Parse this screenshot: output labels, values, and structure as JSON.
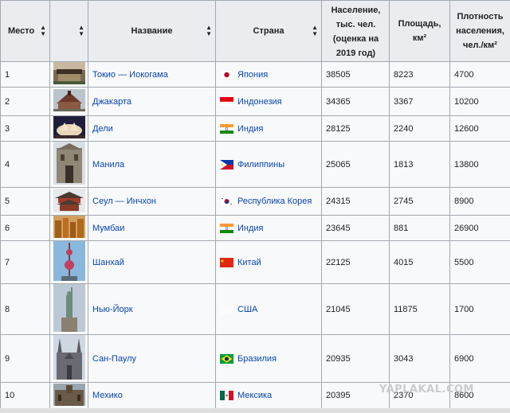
{
  "headers": {
    "rank": "Место",
    "photo": "",
    "name": "Название",
    "country": "Страна",
    "population": "Население, тыс. чел. (оценка на 2019 год)",
    "area": "Площадь, км²",
    "density": "Плотность населения, чел./км²"
  },
  "rows": [
    {
      "rank": "1",
      "name": "Токио — Иокогама",
      "country": "Япония",
      "flag": "japan-flag",
      "population": "38505",
      "area": "8223",
      "density": "4700"
    },
    {
      "rank": "2",
      "name": "Джакарта",
      "country": "Индонезия",
      "flag": "indonesia-flag",
      "population": "34365",
      "area": "3367",
      "density": "10200"
    },
    {
      "rank": "3",
      "name": "Дели",
      "country": "Индия",
      "flag": "india-flag",
      "population": "28125",
      "area": "2240",
      "density": "12600"
    },
    {
      "rank": "4",
      "name": "Манила",
      "country": "Филиппины",
      "flag": "philippines-flag",
      "population": "25065",
      "area": "1813",
      "density": "13800"
    },
    {
      "rank": "5",
      "name": "Сеул — Инчхон",
      "country": "Республика Корея",
      "flag": "korea-flag",
      "population": "24315",
      "area": "2745",
      "density": "8900"
    },
    {
      "rank": "6",
      "name": "Мумбаи",
      "country": "Индия",
      "flag": "india-flag",
      "population": "23645",
      "area": "881",
      "density": "26900"
    },
    {
      "rank": "7",
      "name": "Шанхай",
      "country": "Китай",
      "flag": "china-flag",
      "population": "22125",
      "area": "4015",
      "density": "5500"
    },
    {
      "rank": "8",
      "name": "Нью-Йорк",
      "country": "США",
      "flag": "usa-flag",
      "population": "21045",
      "area": "11875",
      "density": "1700"
    },
    {
      "rank": "9",
      "name": "Сан-Паулу",
      "country": "Бразилия",
      "flag": "brazil-flag",
      "population": "20935",
      "area": "3043",
      "density": "6900"
    },
    {
      "rank": "10",
      "name": "Мехико",
      "country": "Мексика",
      "flag": "mexico-flag",
      "population": "20395",
      "area": "2370",
      "density": "8600"
    }
  ],
  "watermark": "YAPLAKAL.COM",
  "colors": {
    "link": "#0645ad",
    "header_bg": "#eaecf0",
    "cell_bg": "#f8f9fa",
    "border": "#a2a9b1"
  }
}
